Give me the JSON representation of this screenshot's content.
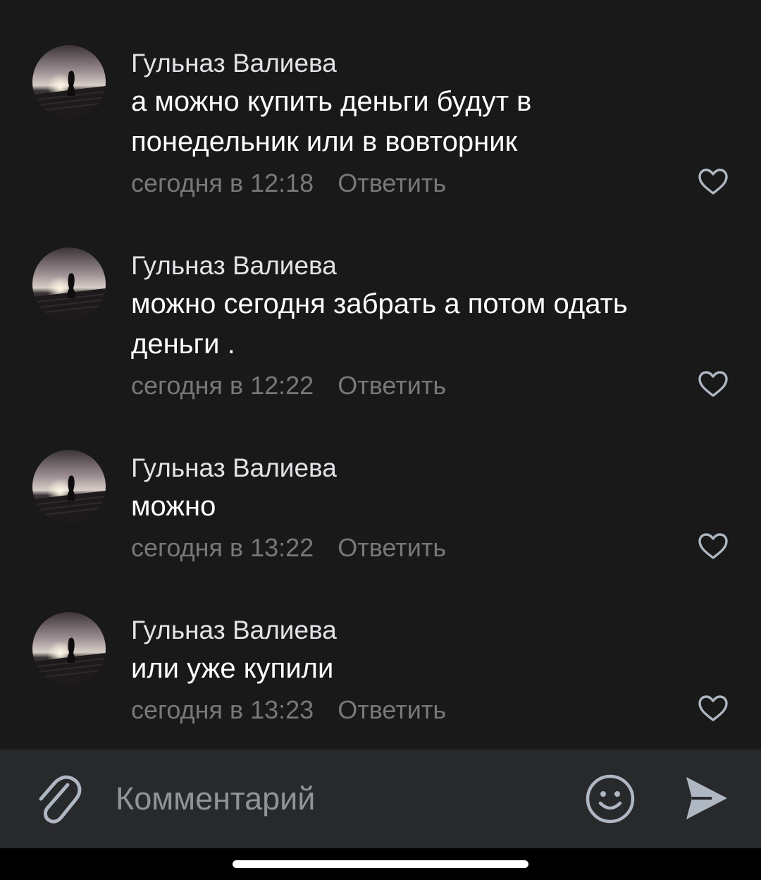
{
  "comments": [
    {
      "author": "Гульназ Валиева",
      "text_lines": [
        "а можно купить деньги будут в",
        "понедельник или в вовторник"
      ],
      "time": "сегодня в 12:18",
      "reply_label": "Ответить",
      "like_icon": "heart-outline-icon"
    },
    {
      "author": "Гульназ Валиева",
      "text_lines": [
        "можно сегодня забрать а потом одать",
        "деньги ."
      ],
      "time": "сегодня в 12:22",
      "reply_label": "Ответить",
      "like_icon": "heart-outline-icon"
    },
    {
      "author": "Гульназ Валиева",
      "text_lines": [
        "можно"
      ],
      "time": "сегодня в 13:22",
      "reply_label": "Ответить",
      "like_icon": "heart-outline-icon"
    },
    {
      "author": "Гульназ Валиева",
      "text_lines": [
        "или уже купили"
      ],
      "time": "сегодня в 13:23",
      "reply_label": "Ответить",
      "like_icon": "heart-outline-icon"
    }
  ],
  "composer": {
    "placeholder": "Комментарий",
    "attach_icon": "paperclip-icon",
    "emoji_icon": "smiley-icon",
    "send_icon": "send-icon"
  },
  "colors": {
    "background": "#19191a",
    "composer_background": "#28292b",
    "primary_text": "#ffffff",
    "secondary_text": "#76787a",
    "icon": "#aeb7c2"
  }
}
